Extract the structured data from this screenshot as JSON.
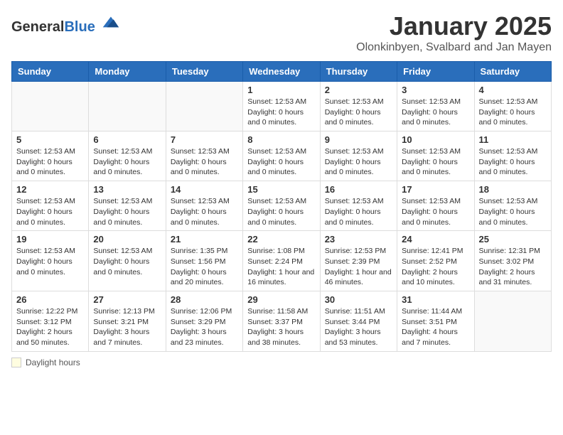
{
  "header": {
    "logo_general": "General",
    "logo_blue": "Blue",
    "month_title": "January 2025",
    "location": "Olonkinbyen, Svalbard and Jan Mayen"
  },
  "days_of_week": [
    "Sunday",
    "Monday",
    "Tuesday",
    "Wednesday",
    "Thursday",
    "Friday",
    "Saturday"
  ],
  "weeks": [
    [
      {
        "day": "",
        "info": ""
      },
      {
        "day": "",
        "info": ""
      },
      {
        "day": "",
        "info": ""
      },
      {
        "day": "1",
        "info": "Sunset: 12:53 AM\nDaylight: 0 hours and 0 minutes."
      },
      {
        "day": "2",
        "info": "Sunset: 12:53 AM\nDaylight: 0 hours and 0 minutes."
      },
      {
        "day": "3",
        "info": "Sunset: 12:53 AM\nDaylight: 0 hours and 0 minutes."
      },
      {
        "day": "4",
        "info": "Sunset: 12:53 AM\nDaylight: 0 hours and 0 minutes."
      }
    ],
    [
      {
        "day": "5",
        "info": "Sunset: 12:53 AM\nDaylight: 0 hours and 0 minutes."
      },
      {
        "day": "6",
        "info": "Sunset: 12:53 AM\nDaylight: 0 hours and 0 minutes."
      },
      {
        "day": "7",
        "info": "Sunset: 12:53 AM\nDaylight: 0 hours and 0 minutes."
      },
      {
        "day": "8",
        "info": "Sunset: 12:53 AM\nDaylight: 0 hours and 0 minutes."
      },
      {
        "day": "9",
        "info": "Sunset: 12:53 AM\nDaylight: 0 hours and 0 minutes."
      },
      {
        "day": "10",
        "info": "Sunset: 12:53 AM\nDaylight: 0 hours and 0 minutes."
      },
      {
        "day": "11",
        "info": "Sunset: 12:53 AM\nDaylight: 0 hours and 0 minutes."
      }
    ],
    [
      {
        "day": "12",
        "info": "Sunset: 12:53 AM\nDaylight: 0 hours and 0 minutes."
      },
      {
        "day": "13",
        "info": "Sunset: 12:53 AM\nDaylight: 0 hours and 0 minutes."
      },
      {
        "day": "14",
        "info": "Sunset: 12:53 AM\nDaylight: 0 hours and 0 minutes."
      },
      {
        "day": "15",
        "info": "Sunset: 12:53 AM\nDaylight: 0 hours and 0 minutes."
      },
      {
        "day": "16",
        "info": "Sunset: 12:53 AM\nDaylight: 0 hours and 0 minutes."
      },
      {
        "day": "17",
        "info": "Sunset: 12:53 AM\nDaylight: 0 hours and 0 minutes."
      },
      {
        "day": "18",
        "info": "Sunset: 12:53 AM\nDaylight: 0 hours and 0 minutes."
      }
    ],
    [
      {
        "day": "19",
        "info": "Sunset: 12:53 AM\nDaylight: 0 hours and 0 minutes."
      },
      {
        "day": "20",
        "info": "Sunset: 12:53 AM\nDaylight: 0 hours and 0 minutes."
      },
      {
        "day": "21",
        "info": "Sunrise: 1:35 PM\nSunset: 1:56 PM\nDaylight: 0 hours and 20 minutes."
      },
      {
        "day": "22",
        "info": "Sunrise: 1:08 PM\nSunset: 2:24 PM\nDaylight: 1 hour and 16 minutes."
      },
      {
        "day": "23",
        "info": "Sunrise: 12:53 PM\nSunset: 2:39 PM\nDaylight: 1 hour and 46 minutes."
      },
      {
        "day": "24",
        "info": "Sunrise: 12:41 PM\nSunset: 2:52 PM\nDaylight: 2 hours and 10 minutes."
      },
      {
        "day": "25",
        "info": "Sunrise: 12:31 PM\nSunset: 3:02 PM\nDaylight: 2 hours and 31 minutes."
      }
    ],
    [
      {
        "day": "26",
        "info": "Sunrise: 12:22 PM\nSunset: 3:12 PM\nDaylight: 2 hours and 50 minutes."
      },
      {
        "day": "27",
        "info": "Sunrise: 12:13 PM\nSunset: 3:21 PM\nDaylight: 3 hours and 7 minutes."
      },
      {
        "day": "28",
        "info": "Sunrise: 12:06 PM\nSunset: 3:29 PM\nDaylight: 3 hours and 23 minutes."
      },
      {
        "day": "29",
        "info": "Sunrise: 11:58 AM\nSunset: 3:37 PM\nDaylight: 3 hours and 38 minutes."
      },
      {
        "day": "30",
        "info": "Sunrise: 11:51 AM\nSunset: 3:44 PM\nDaylight: 3 hours and 53 minutes."
      },
      {
        "day": "31",
        "info": "Sunrise: 11:44 AM\nSunset: 3:51 PM\nDaylight: 4 hours and 7 minutes."
      },
      {
        "day": "",
        "info": ""
      }
    ]
  ],
  "legend": {
    "box_label": "Daylight hours"
  }
}
